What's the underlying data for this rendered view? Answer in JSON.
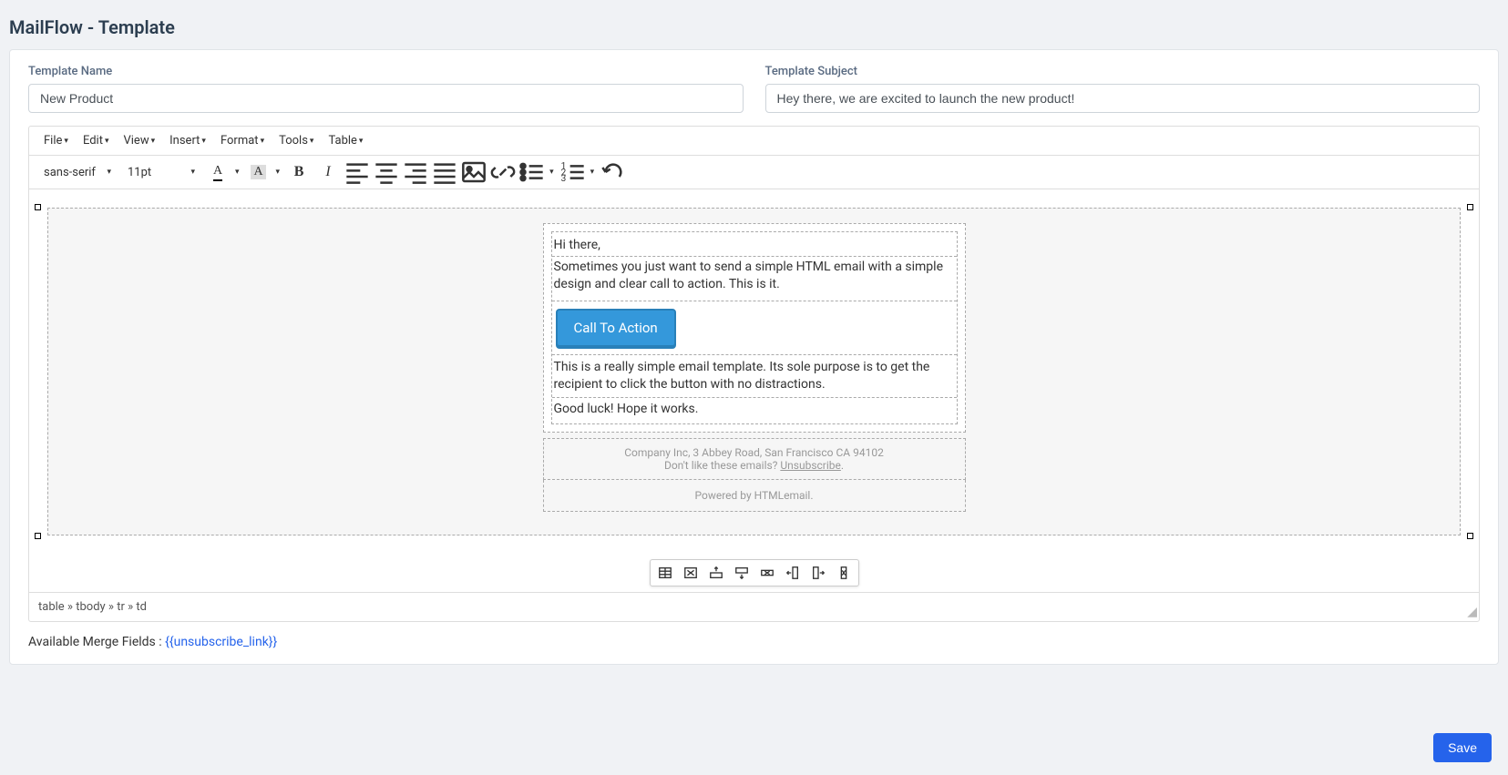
{
  "page": {
    "title": "MailFlow - Template"
  },
  "form": {
    "name_label": "Template Name",
    "name_value": "New Product",
    "subject_label": "Template Subject",
    "subject_value": "Hey there, we are excited to launch the new product!"
  },
  "menubar": [
    "File",
    "Edit",
    "View",
    "Insert",
    "Format",
    "Tools",
    "Table"
  ],
  "toolbar": {
    "font_family": "sans-serif",
    "font_size": "11pt"
  },
  "email": {
    "greeting": "Hi there,",
    "intro": "Sometimes you just want to send a simple HTML email with a simple design and clear call to action. This is it.",
    "cta": "Call To Action",
    "desc": "This is a really simple email template. Its sole purpose is to get the recipient to click the button with no distractions.",
    "luck": "Good luck! Hope it works.",
    "footer_addr": "Company Inc, 3 Abbey Road, San Francisco CA 94102",
    "footer_ask": "Don't like these emails? ",
    "footer_unsub": "Unsubscribe",
    "footer_power": "Powered by HTMLemail."
  },
  "status_path": "table » tbody » tr » td",
  "merge": {
    "label": "Available Merge Fields : ",
    "link": "{{unsubscribe_link}}"
  },
  "save_label": "Save"
}
